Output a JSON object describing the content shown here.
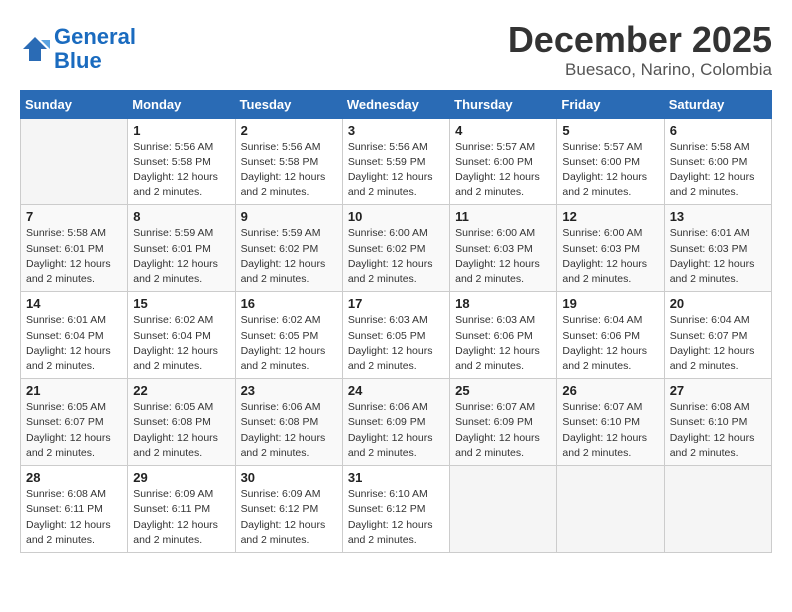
{
  "header": {
    "logo_line1": "General",
    "logo_line2": "Blue",
    "title": "December 2025",
    "subtitle": "Buesaco, Narino, Colombia"
  },
  "calendar": {
    "days_of_week": [
      "Sunday",
      "Monday",
      "Tuesday",
      "Wednesday",
      "Thursday",
      "Friday",
      "Saturday"
    ],
    "weeks": [
      [
        {
          "day": "",
          "info": ""
        },
        {
          "day": "1",
          "info": "Sunrise: 5:56 AM\nSunset: 5:58 PM\nDaylight: 12 hours\nand 2 minutes."
        },
        {
          "day": "2",
          "info": "Sunrise: 5:56 AM\nSunset: 5:58 PM\nDaylight: 12 hours\nand 2 minutes."
        },
        {
          "day": "3",
          "info": "Sunrise: 5:56 AM\nSunset: 5:59 PM\nDaylight: 12 hours\nand 2 minutes."
        },
        {
          "day": "4",
          "info": "Sunrise: 5:57 AM\nSunset: 6:00 PM\nDaylight: 12 hours\nand 2 minutes."
        },
        {
          "day": "5",
          "info": "Sunrise: 5:57 AM\nSunset: 6:00 PM\nDaylight: 12 hours\nand 2 minutes."
        },
        {
          "day": "6",
          "info": "Sunrise: 5:58 AM\nSunset: 6:00 PM\nDaylight: 12 hours\nand 2 minutes."
        }
      ],
      [
        {
          "day": "7",
          "info": "Sunrise: 5:58 AM\nSunset: 6:01 PM\nDaylight: 12 hours\nand 2 minutes."
        },
        {
          "day": "8",
          "info": "Sunrise: 5:59 AM\nSunset: 6:01 PM\nDaylight: 12 hours\nand 2 minutes."
        },
        {
          "day": "9",
          "info": "Sunrise: 5:59 AM\nSunset: 6:02 PM\nDaylight: 12 hours\nand 2 minutes."
        },
        {
          "day": "10",
          "info": "Sunrise: 6:00 AM\nSunset: 6:02 PM\nDaylight: 12 hours\nand 2 minutes."
        },
        {
          "day": "11",
          "info": "Sunrise: 6:00 AM\nSunset: 6:03 PM\nDaylight: 12 hours\nand 2 minutes."
        },
        {
          "day": "12",
          "info": "Sunrise: 6:00 AM\nSunset: 6:03 PM\nDaylight: 12 hours\nand 2 minutes."
        },
        {
          "day": "13",
          "info": "Sunrise: 6:01 AM\nSunset: 6:03 PM\nDaylight: 12 hours\nand 2 minutes."
        }
      ],
      [
        {
          "day": "14",
          "info": "Sunrise: 6:01 AM\nSunset: 6:04 PM\nDaylight: 12 hours\nand 2 minutes."
        },
        {
          "day": "15",
          "info": "Sunrise: 6:02 AM\nSunset: 6:04 PM\nDaylight: 12 hours\nand 2 minutes."
        },
        {
          "day": "16",
          "info": "Sunrise: 6:02 AM\nSunset: 6:05 PM\nDaylight: 12 hours\nand 2 minutes."
        },
        {
          "day": "17",
          "info": "Sunrise: 6:03 AM\nSunset: 6:05 PM\nDaylight: 12 hours\nand 2 minutes."
        },
        {
          "day": "18",
          "info": "Sunrise: 6:03 AM\nSunset: 6:06 PM\nDaylight: 12 hours\nand 2 minutes."
        },
        {
          "day": "19",
          "info": "Sunrise: 6:04 AM\nSunset: 6:06 PM\nDaylight: 12 hours\nand 2 minutes."
        },
        {
          "day": "20",
          "info": "Sunrise: 6:04 AM\nSunset: 6:07 PM\nDaylight: 12 hours\nand 2 minutes."
        }
      ],
      [
        {
          "day": "21",
          "info": "Sunrise: 6:05 AM\nSunset: 6:07 PM\nDaylight: 12 hours\nand 2 minutes."
        },
        {
          "day": "22",
          "info": "Sunrise: 6:05 AM\nSunset: 6:08 PM\nDaylight: 12 hours\nand 2 minutes."
        },
        {
          "day": "23",
          "info": "Sunrise: 6:06 AM\nSunset: 6:08 PM\nDaylight: 12 hours\nand 2 minutes."
        },
        {
          "day": "24",
          "info": "Sunrise: 6:06 AM\nSunset: 6:09 PM\nDaylight: 12 hours\nand 2 minutes."
        },
        {
          "day": "25",
          "info": "Sunrise: 6:07 AM\nSunset: 6:09 PM\nDaylight: 12 hours\nand 2 minutes."
        },
        {
          "day": "26",
          "info": "Sunrise: 6:07 AM\nSunset: 6:10 PM\nDaylight: 12 hours\nand 2 minutes."
        },
        {
          "day": "27",
          "info": "Sunrise: 6:08 AM\nSunset: 6:10 PM\nDaylight: 12 hours\nand 2 minutes."
        }
      ],
      [
        {
          "day": "28",
          "info": "Sunrise: 6:08 AM\nSunset: 6:11 PM\nDaylight: 12 hours\nand 2 minutes."
        },
        {
          "day": "29",
          "info": "Sunrise: 6:09 AM\nSunset: 6:11 PM\nDaylight: 12 hours\nand 2 minutes."
        },
        {
          "day": "30",
          "info": "Sunrise: 6:09 AM\nSunset: 6:12 PM\nDaylight: 12 hours\nand 2 minutes."
        },
        {
          "day": "31",
          "info": "Sunrise: 6:10 AM\nSunset: 6:12 PM\nDaylight: 12 hours\nand 2 minutes."
        },
        {
          "day": "",
          "info": ""
        },
        {
          "day": "",
          "info": ""
        },
        {
          "day": "",
          "info": ""
        }
      ]
    ]
  }
}
